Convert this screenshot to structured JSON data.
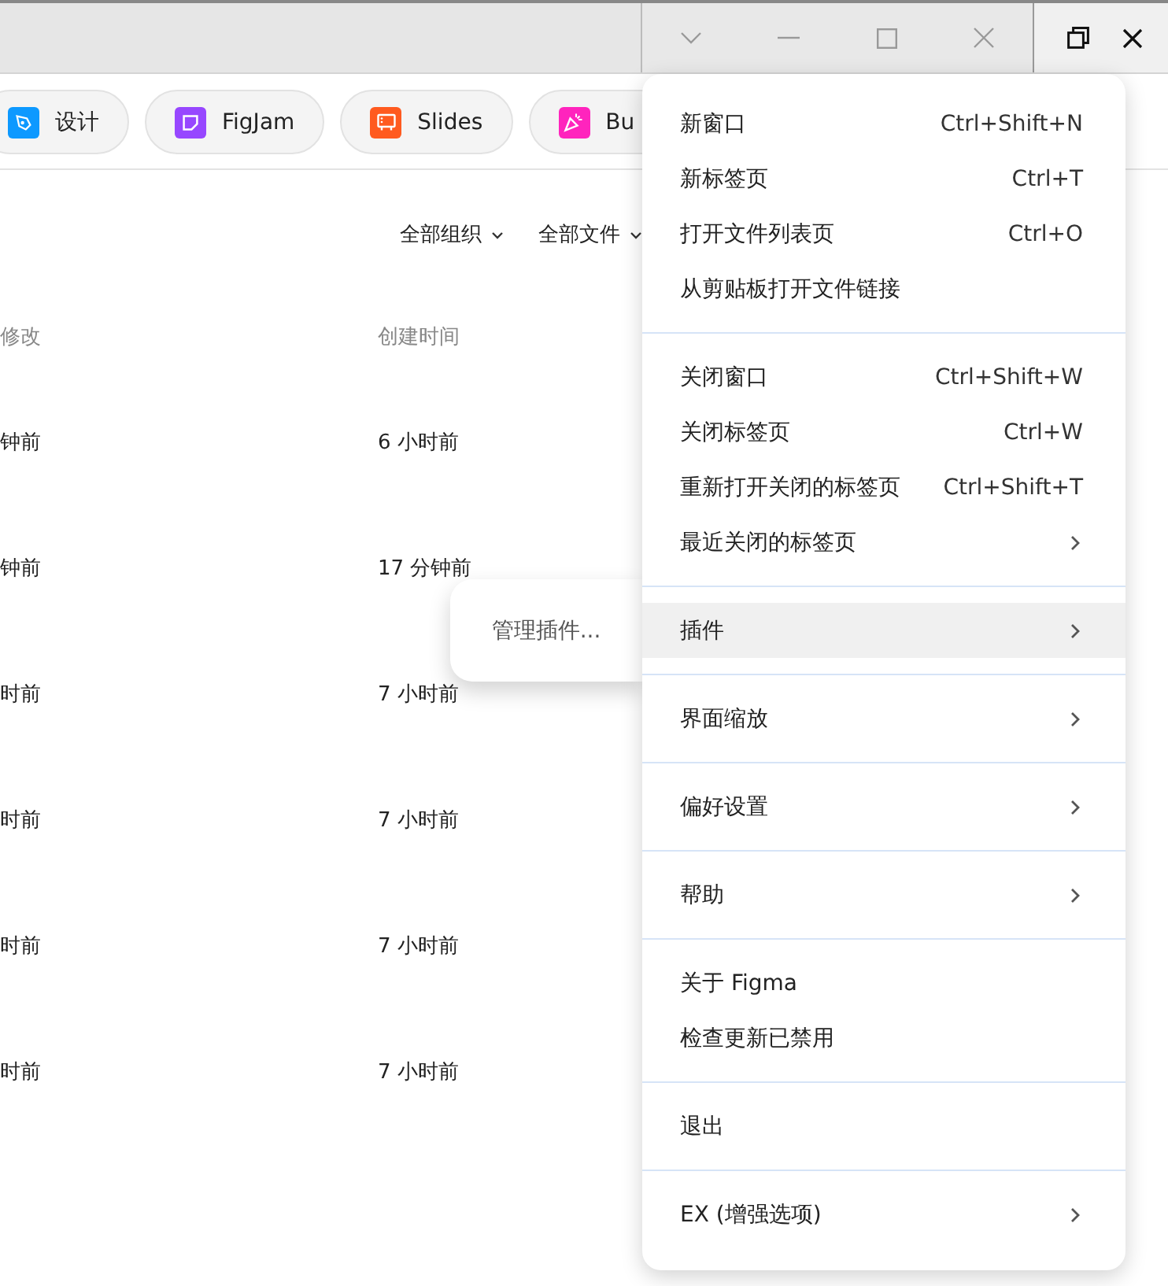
{
  "app_tabs": [
    {
      "label": "设计",
      "color": "#0d99ff",
      "kind": "design"
    },
    {
      "label": "FigJam",
      "color": "#9747ff",
      "kind": "figjam"
    },
    {
      "label": "Slides",
      "color": "#ff5a1f",
      "kind": "slides"
    },
    {
      "label": "Bu",
      "color": "#ff24bd",
      "kind": "buzz"
    }
  ],
  "filters": [
    {
      "label": "全部组织"
    },
    {
      "label": "全部文件"
    }
  ],
  "table": {
    "columns": [
      "修改",
      "创建时间"
    ],
    "rows": [
      [
        "钟前",
        "6 小时前"
      ],
      [
        "钟前",
        "17 分钟前"
      ],
      [
        "时前",
        "7 小时前"
      ],
      [
        "时前",
        "7 小时前"
      ],
      [
        "时前",
        "7 小时前"
      ],
      [
        "时前",
        "7 小时前"
      ]
    ]
  },
  "menu": {
    "sections": [
      {
        "items": [
          {
            "label": "新窗口",
            "shortcut": "Ctrl+Shift+N",
            "submenu": false,
            "selected": false
          },
          {
            "label": "新标签页",
            "shortcut": "Ctrl+T",
            "submenu": false,
            "selected": false
          },
          {
            "label": "打开文件列表页",
            "shortcut": "Ctrl+O",
            "submenu": false,
            "selected": false
          },
          {
            "label": "从剪贴板打开文件链接",
            "submenu": false,
            "selected": false
          }
        ]
      },
      {
        "items": [
          {
            "label": "关闭窗口",
            "shortcut": "Ctrl+Shift+W",
            "submenu": false,
            "selected": false
          },
          {
            "label": "关闭标签页",
            "shortcut": "Ctrl+W",
            "submenu": false,
            "selected": false
          },
          {
            "label": "重新打开关闭的标签页",
            "shortcut": "Ctrl+Shift+T",
            "submenu": false,
            "selected": false
          },
          {
            "label": "最近关闭的标签页",
            "submenu": true,
            "selected": false
          }
        ]
      },
      {
        "items": [
          {
            "label": "插件",
            "submenu": true,
            "selected": true
          }
        ]
      },
      {
        "items": [
          {
            "label": "界面缩放",
            "submenu": true,
            "selected": false
          }
        ]
      },
      {
        "items": [
          {
            "label": "偏好设置",
            "submenu": true,
            "selected": false
          }
        ]
      },
      {
        "items": [
          {
            "label": "帮助",
            "submenu": true,
            "selected": false
          }
        ]
      },
      {
        "items": [
          {
            "label": "关于 Figma",
            "submenu": false,
            "selected": false
          },
          {
            "label": "检查更新已禁用",
            "submenu": false,
            "selected": false
          }
        ]
      },
      {
        "items": [
          {
            "label": "退出",
            "submenu": false,
            "selected": false
          }
        ]
      },
      {
        "items": [
          {
            "label": "EX (增强选项)",
            "submenu": true,
            "selected": false
          }
        ]
      }
    ]
  },
  "submenu": {
    "items": [
      {
        "label": "管理插件..."
      }
    ]
  }
}
